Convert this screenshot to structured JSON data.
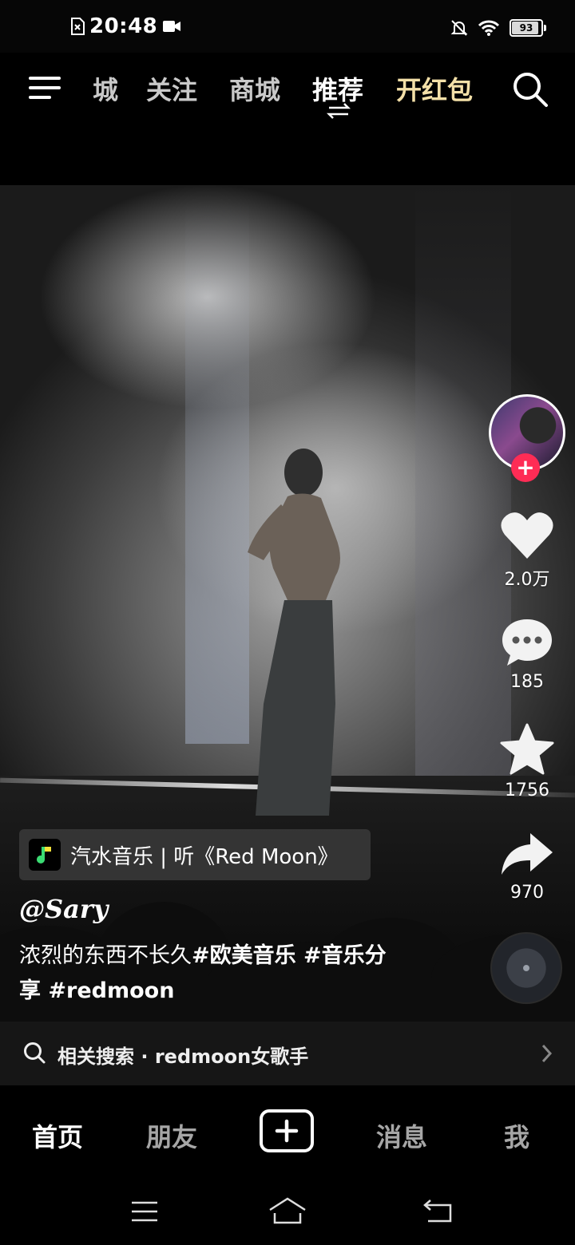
{
  "status_bar": {
    "time": "20:48",
    "battery": "93"
  },
  "top_nav": {
    "tabs": [
      {
        "label": "城"
      },
      {
        "label": "关注"
      },
      {
        "label": "商城"
      },
      {
        "label": "推荐"
      },
      {
        "label": "开红包"
      }
    ]
  },
  "side_rail": {
    "likes": "2.0万",
    "comments": "185",
    "favorites": "1756",
    "shares": "970"
  },
  "music": {
    "label": "汽水音乐 | 听《Red Moon》"
  },
  "post": {
    "author": "@Sary",
    "caption_plain": "浓烈的东西不长久",
    "caption_tags_line1": "#欧美音乐 #音乐分",
    "caption_tags_line2": "享 #redmoon"
  },
  "related_search": {
    "text": "相关搜索 · redmoon女歌手"
  },
  "bottom_nav": {
    "items": [
      {
        "label": "首页"
      },
      {
        "label": "朋友"
      },
      {
        "label": "消息"
      },
      {
        "label": "我"
      }
    ]
  },
  "icons": {
    "menu": "menu-icon",
    "search": "search-icon",
    "like": "heart-icon",
    "comment": "comment-icon",
    "favorite": "star-icon",
    "share": "share-icon",
    "create": "plus-icon",
    "battery": "battery-icon"
  },
  "colors": {
    "follow": "#fe2c55",
    "red_packet_tab": "#f4e0a8",
    "background": "#000000"
  }
}
